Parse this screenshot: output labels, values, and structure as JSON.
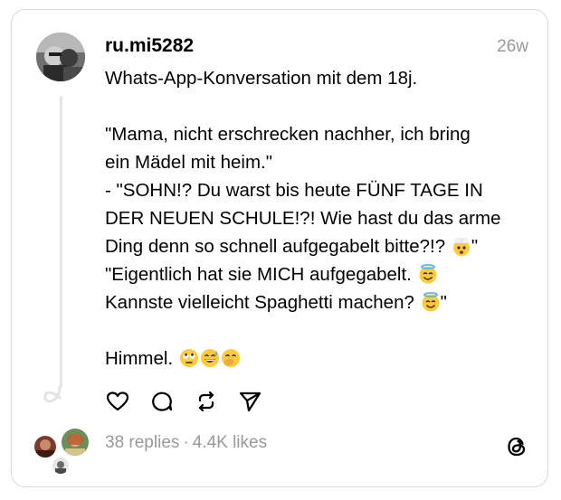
{
  "post": {
    "username": "ru.mi5282",
    "timestamp": "26w",
    "lines": [
      "Whats-App-Konversation mit dem 18j.",
      "",
      "\"Mama, nicht erschrecken nachher, ich bring",
      "ein Mädel mit heim.\"",
      "- \"SOHN!? Du warst bis heute FÜNF TAGE IN",
      "DER NEUEN SCHULE!?! Wie hast du das arme",
      "Ding denn so schnell aufgegabelt bitte?!?",
      "\"Eigentlich hat sie MICH aufgegabelt.",
      "Kannste vielleicht Spaghetti machen?",
      "",
      "Himmel."
    ],
    "line7_tail": "\"",
    "line9_tail": "\"",
    "emojis": {
      "line7": "exploding-head-emoji",
      "line8": "smiling-face-with-halo-emoji",
      "line9": "smiling-face-with-halo-emoji",
      "line11": [
        "face-with-rolling-eyes-emoji",
        "grinning-face-with-sweat-emoji",
        "face-with-hand-over-mouth-emoji"
      ]
    }
  },
  "actions": {
    "like": "heart-icon",
    "reply": "comment-icon",
    "repost": "repost-icon",
    "share": "send-icon"
  },
  "footer": {
    "replies": "38 replies",
    "separator": "·",
    "likes": "4.4K likes",
    "logo": "threads-logo-icon"
  },
  "colors": {
    "text": "#000000",
    "muted": "#999999",
    "border": "#d9d9d9",
    "thread_line": "#e6e6e6",
    "emoji_yellow": "#ffcb3d"
  }
}
